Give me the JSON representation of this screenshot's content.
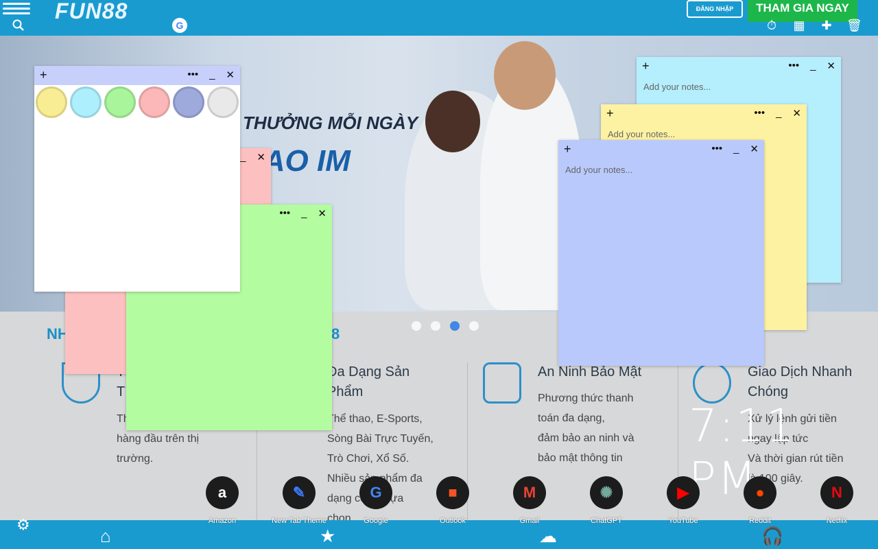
{
  "site": {
    "logo": "FUN88",
    "login_label": "ĐĂNG NHẬP",
    "join_label": "THAM GIA NGAY",
    "promo_line1": "THƯỞNG MỖI NGÀY",
    "promo_line2": "HAO IM",
    "section_title_left": "NH",
    "section_title_right": "8",
    "features": [
      {
        "title": "T\nTí",
        "text": "Th\nhàng đầu trên thị\ntrường."
      },
      {
        "title": "Đa Dạng Sản\nPhẩm",
        "text": "Thể thao, E-Sports,\nSòng Bài Trực Tuyến,\nTrò Chơi, Xổ Số.\nNhiều sản phẩm đa\ndạng có thể lựa\nchọn"
      },
      {
        "title": "An Ninh Bảo Mật",
        "text": "Phương thức thanh\ntoán đa dạng,\nđảm bảo an ninh và\nbảo mật thông tin"
      },
      {
        "title": "Giao Dịch Nhanh\nChóng",
        "text": "Xử lý lệnh gửi tiền\nngay lập tức\nVà thời gian rút tiền\nlà 100 giây."
      }
    ]
  },
  "clock": "7:11 PM",
  "notes": {
    "placeholder": "Add your notes...",
    "add_label": "+",
    "more_label": "•••",
    "minimize_label": "_",
    "close_label": "✕",
    "palette": [
      "#f9ed94",
      "#aeeffd",
      "#a9f59b",
      "#fcb8b8",
      "#9ea9dc",
      "#e9e9e9"
    ]
  },
  "shortcuts": [
    {
      "label": "Amazon",
      "icon": "amazon-icon",
      "glyph": "a",
      "color": "#ffffff"
    },
    {
      "label": "New Tab Theme",
      "icon": "new-tab-theme-icon",
      "glyph": "✎",
      "color": "#3b7bf7"
    },
    {
      "label": "Google",
      "icon": "google-icon",
      "glyph": "G",
      "color": "#4285f4"
    },
    {
      "label": "Outlook",
      "icon": "outlook-icon",
      "glyph": "■",
      "color": "#f35325"
    },
    {
      "label": "Gmail",
      "icon": "gmail-icon",
      "glyph": "M",
      "color": "#ea4335"
    },
    {
      "label": "ChatGPT",
      "icon": "chatgpt-icon",
      "glyph": "✺",
      "color": "#74aa9c"
    },
    {
      "label": "YouTube",
      "icon": "youtube-icon",
      "glyph": "▶",
      "color": "#ff0000"
    },
    {
      "label": "Reddit",
      "icon": "reddit-icon",
      "glyph": "●",
      "color": "#ff4500"
    },
    {
      "label": "Netflix",
      "icon": "netflix-icon",
      "glyph": "N",
      "color": "#e50914"
    }
  ]
}
